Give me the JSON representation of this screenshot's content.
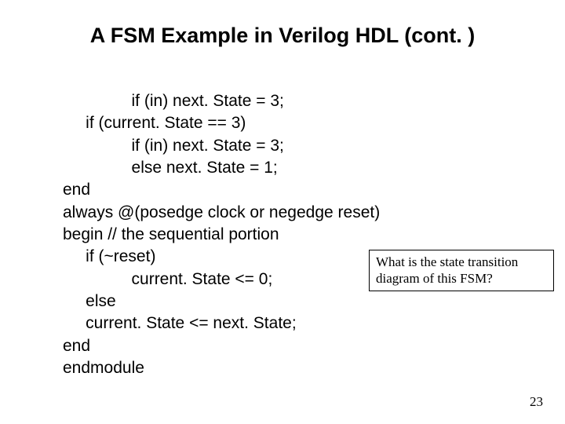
{
  "title": "A FSM Example in Verilog HDL (cont. )",
  "code": {
    "l1": "               if (in) next. State = 3;",
    "l2": "     if (current. State == 3)",
    "l3": "               if (in) next. State = 3;",
    "l4": "               else next. State = 1;",
    "l5": "end",
    "l6": "always @(posedge clock or negedge reset)",
    "l7": "begin // the sequential portion",
    "l8": "     if (~reset)",
    "l9": "               current. State <= 0;",
    "l10": "     else",
    "l11": "     current. State <= next. State;",
    "l12": "end",
    "l13": "endmodule"
  },
  "callout": {
    "line1": "What is the state transition",
    "line2": "diagram of this FSM?"
  },
  "page_number": "23"
}
